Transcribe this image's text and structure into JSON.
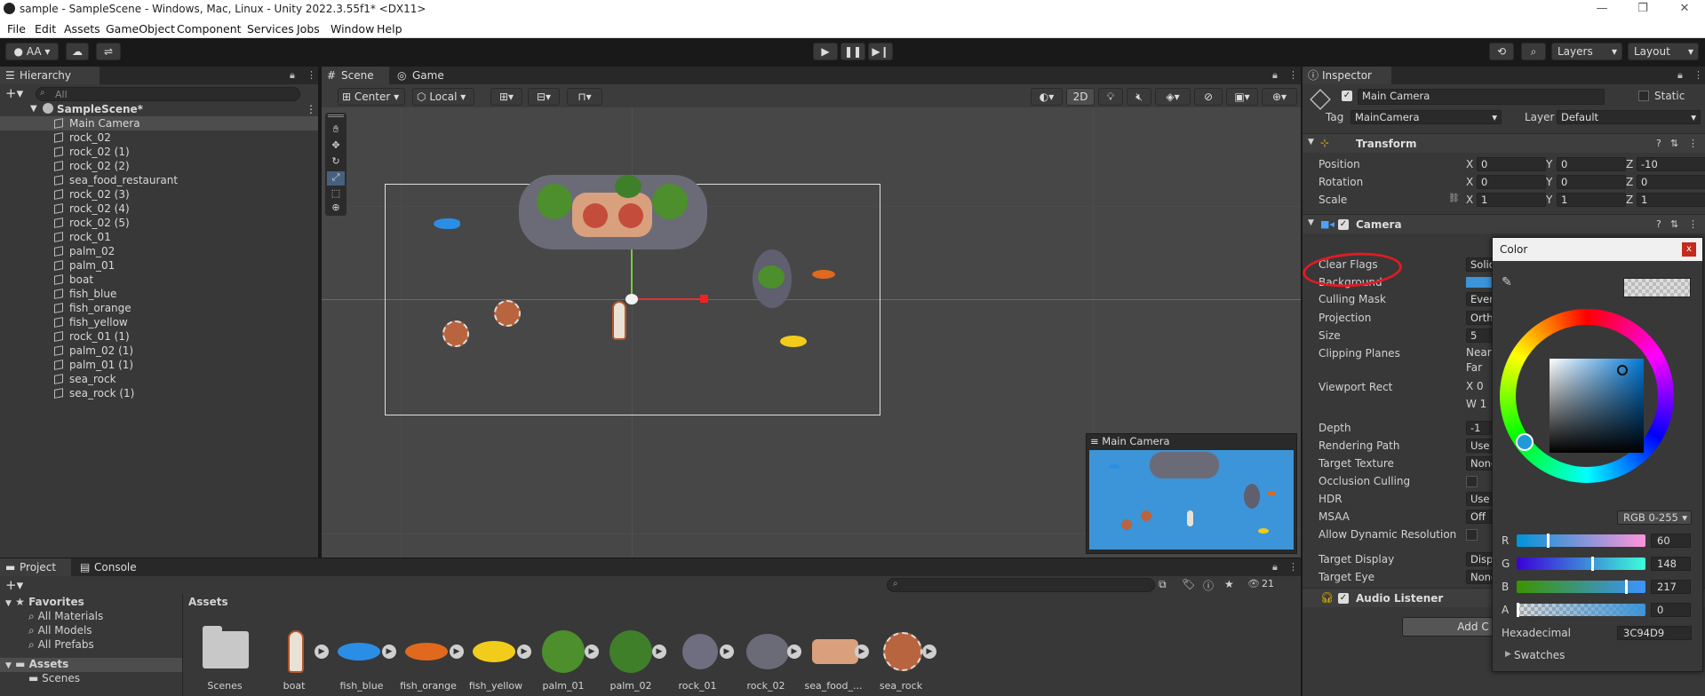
{
  "window": {
    "title": "sample - SampleScene - Windows, Mac, Linux - Unity 2022.3.55f1* <DX11>"
  },
  "menu": [
    "File",
    "Edit",
    "Assets",
    "GameObject",
    "Component",
    "Services",
    "Jobs",
    "Window",
    "Help"
  ],
  "toolbar": {
    "account": "AA",
    "layers": "Layers",
    "layout": "Layout"
  },
  "hierarchy": {
    "tab": "Hierarchy",
    "search_placeholder": "All",
    "scene": "SampleScene*",
    "items": [
      "Main Camera",
      "rock_02",
      "rock_02 (1)",
      "rock_02 (2)",
      "sea_food_restaurant",
      "rock_02 (3)",
      "rock_02 (4)",
      "rock_02 (5)",
      "rock_01",
      "palm_02",
      "palm_01",
      "boat",
      "fish_blue",
      "fish_orange",
      "fish_yellow",
      "rock_01 (1)",
      "palm_02 (1)",
      "palm_01 (1)",
      "sea_rock",
      "sea_rock (1)"
    ]
  },
  "scene_view": {
    "tabs": [
      "Scene",
      "Game"
    ],
    "pivot": "Center",
    "space": "Local",
    "mode_2d": "2D",
    "preview_title": "Main Camera"
  },
  "inspector": {
    "tab": "Inspector",
    "object_name": "Main Camera",
    "static_label": "Static",
    "tag_label": "Tag",
    "tag_value": "MainCamera",
    "layer_label": "Layer",
    "layer_value": "Default",
    "transform": {
      "title": "Transform",
      "position_label": "Position",
      "position": [
        "0",
        "0",
        "-10"
      ],
      "rotation_label": "Rotation",
      "rotation": [
        "0",
        "0",
        "0"
      ],
      "scale_label": "Scale",
      "scale": [
        "1",
        "1",
        "1"
      ]
    },
    "camera": {
      "title": "Camera",
      "rows": [
        {
          "label": "Clear Flags",
          "value": "Solid"
        },
        {
          "label": "Background",
          "value": ""
        },
        {
          "label": "Culling Mask",
          "value": "Every"
        },
        {
          "label": "Projection",
          "value": "Ortho"
        },
        {
          "label": "Size",
          "value": "5"
        },
        {
          "label": "Clipping Planes",
          "value": "Near"
        },
        {
          "label": "",
          "value": "Far"
        },
        {
          "label": "Viewport Rect",
          "value": "X 0"
        },
        {
          "label": "",
          "value": "W 1"
        },
        {
          "label": "Depth",
          "value": "-1"
        },
        {
          "label": "Rendering Path",
          "value": "Use"
        },
        {
          "label": "Target Texture",
          "value": "None"
        },
        {
          "label": "Occlusion Culling",
          "value": ""
        },
        {
          "label": "HDR",
          "value": "Use"
        },
        {
          "label": "MSAA",
          "value": "Off"
        },
        {
          "label": "Allow Dynamic Resolution",
          "value": ""
        },
        {
          "label": "Target Display",
          "value": "Disp"
        },
        {
          "label": "Target Eye",
          "value": "None"
        }
      ]
    },
    "audio_listener": "Audio Listener",
    "add_component": "Add C"
  },
  "color_picker": {
    "title": "Color",
    "mode": "RGB 0-255",
    "r_label": "R",
    "r": "60",
    "g_label": "G",
    "g": "148",
    "b_label": "B",
    "b": "217",
    "a_label": "A",
    "a": "0",
    "hex_label": "Hexadecimal",
    "hex": "3C94D9",
    "swatches": "Swatches",
    "color": "#3C94D9"
  },
  "project": {
    "tabs": [
      "Project",
      "Console"
    ],
    "favorites": "Favorites",
    "favorite_items": [
      "All Materials",
      "All Models",
      "All Prefabs"
    ],
    "assets_root": "Assets",
    "scenes_folder": "Scenes",
    "breadcrumb": "Assets",
    "count": "21",
    "assets": [
      "Scenes",
      "boat",
      "fish_blue",
      "fish_orange",
      "fish_yellow",
      "palm_01",
      "palm_02",
      "rock_01",
      "rock_02",
      "sea_food_...",
      "sea_rock"
    ]
  }
}
